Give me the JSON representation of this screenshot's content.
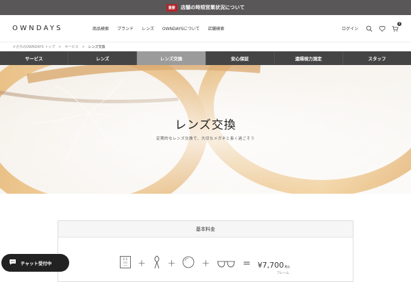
{
  "notice": {
    "badge": "重要",
    "text": "店舗の時短営業状況について"
  },
  "header": {
    "logo": "OWNDAYS",
    "nav": [
      "商品検索",
      "ブランド",
      "レンズ",
      "OWNDAYSについて",
      "店舗検索"
    ],
    "login": "ログイン",
    "cart_count": "0"
  },
  "breadcrumb": {
    "items": [
      "メガネのOWNDAYS トップ",
      "サービス",
      "レンズ交換"
    ],
    "separator": ">"
  },
  "tabs": [
    {
      "label": "サービス",
      "active": false
    },
    {
      "label": "レンズ",
      "active": false
    },
    {
      "label": "レンズ交換",
      "active": true
    },
    {
      "label": "安心保証",
      "active": false
    },
    {
      "label": "遠隔視力測定",
      "active": false
    },
    {
      "label": "スタッフ",
      "active": false
    }
  ],
  "hero": {
    "title": "レンズ交換",
    "subtitle": "定期的なレンズ交換で、大切なメガネと長く過ごそう"
  },
  "fee": {
    "heading": "基本料金",
    "price": "¥7,700",
    "tax": "税込",
    "frame_label": "フレーム"
  },
  "chat": {
    "label": "チャット受付中"
  },
  "colors": {
    "notice_bg": "#595757",
    "badge_red": "#b3252a",
    "tab_bg": "#444444",
    "tab_active": "#9b9b9b"
  }
}
